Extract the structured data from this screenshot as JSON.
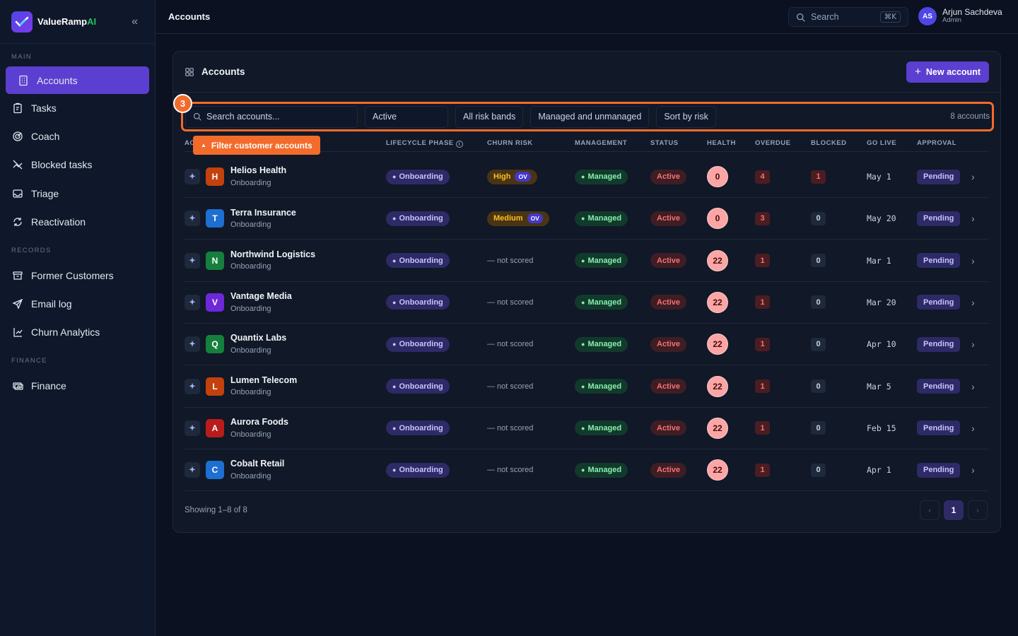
{
  "brand": {
    "name_prefix": "ValueRamp",
    "name_suffix": "AI",
    "collapse_icon": "«"
  },
  "sidebar": {
    "sections": [
      {
        "label": "MAIN",
        "items": [
          {
            "label": "Accounts",
            "icon": "building-icon",
            "active": true
          },
          {
            "label": "Tasks",
            "icon": "clipboard-icon"
          },
          {
            "label": "Coach",
            "icon": "target-icon"
          },
          {
            "label": "Blocked tasks",
            "icon": "chart-off-icon"
          },
          {
            "label": "Triage",
            "icon": "inbox-icon"
          },
          {
            "label": "Reactivation",
            "icon": "refresh-icon"
          }
        ]
      },
      {
        "label": "RECORDS",
        "items": [
          {
            "label": "Former Customers",
            "icon": "archive-icon"
          },
          {
            "label": "Email log",
            "icon": "send-icon"
          },
          {
            "label": "Churn Analytics",
            "icon": "chart-up-icon"
          }
        ]
      },
      {
        "label": "FINANCE",
        "items": [
          {
            "label": "Finance",
            "icon": "cash-icon"
          }
        ]
      }
    ]
  },
  "topbar": {
    "title": "Accounts",
    "search_placeholder": "Search",
    "search_shortcut": "⌘K",
    "user": {
      "initials": "AS",
      "name": "Arjun Sachdeva",
      "role": "Admin"
    }
  },
  "card": {
    "title": "Accounts",
    "new_button": "New account",
    "step_number": "3",
    "tooltip": "Filter customer accounts",
    "filters": {
      "search_placeholder": "Search accounts...",
      "status": "Active",
      "risk": "All risk bands",
      "management": "Managed and unmanaged",
      "sort": "Sort by risk",
      "count": "8 accounts"
    },
    "columns": [
      "AC",
      "LIFECYCLE PHASE",
      "CHURN RISK",
      "MANAGEMENT",
      "STATUS",
      "HEALTH",
      "OVERDUE",
      "BLOCKED",
      "GO LIVE",
      "APPROVAL"
    ],
    "rows": [
      {
        "letter": "H",
        "color": "#c2410c",
        "name": "Helios Health",
        "sub": "Onboarding",
        "phase": "Onboarding",
        "risk": "High",
        "risk_tag": "OV",
        "management": "Managed",
        "status": "Active",
        "health": "0",
        "overdue": "4",
        "blocked": "1",
        "golive": "May 1",
        "approval": "Pending"
      },
      {
        "letter": "T",
        "color": "#1d6fd1",
        "name": "Terra Insurance",
        "sub": "Onboarding",
        "phase": "Onboarding",
        "risk": "Medium",
        "risk_tag": "OV",
        "management": "Managed",
        "status": "Active",
        "health": "0",
        "overdue": "3",
        "blocked": "0",
        "golive": "May 20",
        "approval": "Pending"
      },
      {
        "letter": "N",
        "color": "#15803d",
        "name": "Northwind Logistics",
        "sub": "Onboarding",
        "phase": "Onboarding",
        "risk": "— not scored",
        "risk_tag": "",
        "management": "Managed",
        "status": "Active",
        "health": "22",
        "overdue": "1",
        "blocked": "0",
        "golive": "Mar 1",
        "approval": "Pending"
      },
      {
        "letter": "V",
        "color": "#6d28d9",
        "name": "Vantage Media",
        "sub": "Onboarding",
        "phase": "Onboarding",
        "risk": "— not scored",
        "risk_tag": "",
        "management": "Managed",
        "status": "Active",
        "health": "22",
        "overdue": "1",
        "blocked": "0",
        "golive": "Mar 20",
        "approval": "Pending"
      },
      {
        "letter": "Q",
        "color": "#15803d",
        "name": "Quantix Labs",
        "sub": "Onboarding",
        "phase": "Onboarding",
        "risk": "— not scored",
        "risk_tag": "",
        "management": "Managed",
        "status": "Active",
        "health": "22",
        "overdue": "1",
        "blocked": "0",
        "golive": "Apr 10",
        "approval": "Pending"
      },
      {
        "letter": "L",
        "color": "#c2410c",
        "name": "Lumen Telecom",
        "sub": "Onboarding",
        "phase": "Onboarding",
        "risk": "— not scored",
        "risk_tag": "",
        "management": "Managed",
        "status": "Active",
        "health": "22",
        "overdue": "1",
        "blocked": "0",
        "golive": "Mar 5",
        "approval": "Pending"
      },
      {
        "letter": "A",
        "color": "#b91c1c",
        "name": "Aurora Foods",
        "sub": "Onboarding",
        "phase": "Onboarding",
        "risk": "— not scored",
        "risk_tag": "",
        "management": "Managed",
        "status": "Active",
        "health": "22",
        "overdue": "1",
        "blocked": "0",
        "golive": "Feb 15",
        "approval": "Pending"
      },
      {
        "letter": "C",
        "color": "#1d6fd1",
        "name": "Cobalt Retail",
        "sub": "Onboarding",
        "phase": "Onboarding",
        "risk": "— not scored",
        "risk_tag": "",
        "management": "Managed",
        "status": "Active",
        "health": "22",
        "overdue": "1",
        "blocked": "0",
        "golive": "Apr 1",
        "approval": "Pending"
      }
    ],
    "footer": {
      "showing": "Showing 1–8 of 8",
      "current_page": "1",
      "prev": "‹",
      "next": "›"
    }
  }
}
